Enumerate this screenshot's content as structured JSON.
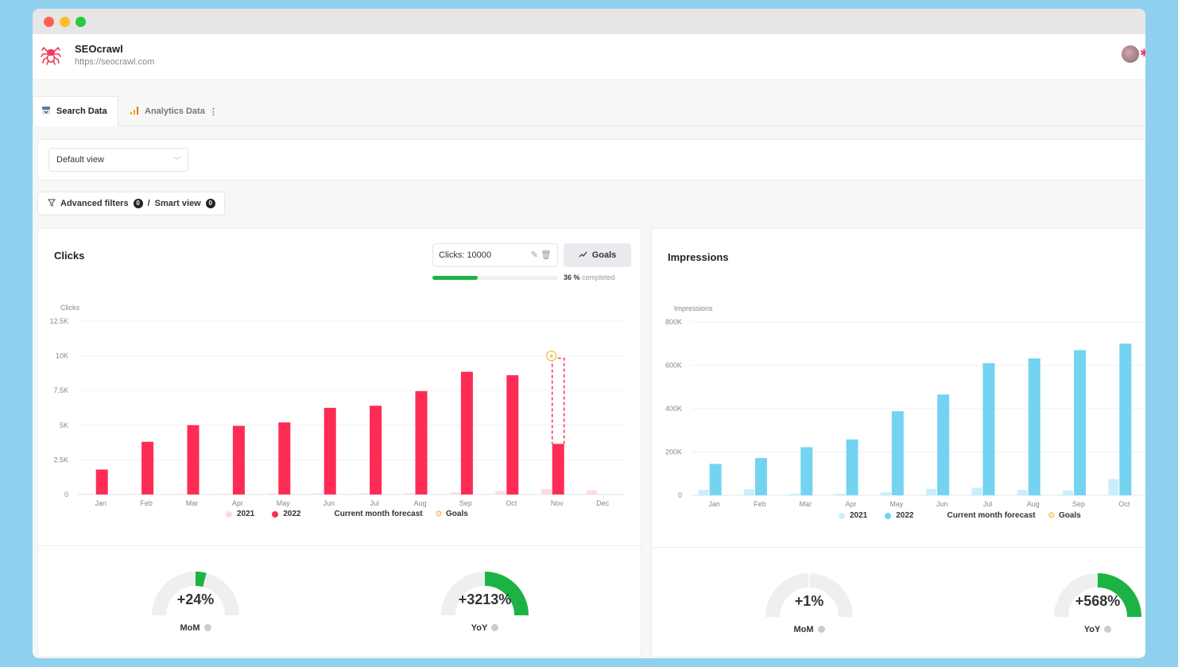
{
  "app": {
    "site_name": "SEOcrawl",
    "site_url": "https://seocrawl.com"
  },
  "tabs": [
    {
      "label": "Search Data",
      "icon": "search-console-icon",
      "active": true
    },
    {
      "label": "Analytics Data",
      "icon": "analytics-bar-icon",
      "active": false
    }
  ],
  "view_select": {
    "value": "Default view"
  },
  "filters": {
    "advanced_label": "Advanced filters",
    "advanced_count": "0",
    "separator": "/",
    "smart_label": "Smart view",
    "smart_count": "0"
  },
  "clicks_panel": {
    "title": "Clicks",
    "goal_input_value": "Clicks: 10000",
    "goals_button": "Goals",
    "progress_percent": 36,
    "progress_value_text": "36 %",
    "progress_suffix": "completed",
    "legend": {
      "y2021": "2021",
      "y2022": "2022",
      "forecast": "Current month forecast",
      "goals": "Goals"
    },
    "gauges": [
      {
        "value": "+24%",
        "label": "MoM",
        "fill": 0.08
      },
      {
        "value": "+3213%",
        "label": "YoY",
        "fill": 0.5
      }
    ]
  },
  "impressions_panel": {
    "title": "Impressions",
    "legend": {
      "y2021": "2021",
      "y2022": "2022",
      "forecast": "Current month forecast",
      "goals": "Goals"
    },
    "gauges": [
      {
        "value": "+1%",
        "label": "MoM",
        "fill": 0.0
      },
      {
        "value": "+568%",
        "label": "YoY",
        "fill": 0.5
      }
    ]
  },
  "colors": {
    "clicks_2022": "#fe2c55",
    "clicks_2021": "#fcdbe3",
    "impr_2022": "#74d3f1",
    "impr_2021": "#c9eefb",
    "goal_green": "#1db344",
    "goal_star": "#f5b942"
  },
  "chart_data": [
    {
      "type": "bar",
      "title": "Clicks",
      "ylabel": "Clicks",
      "categories": [
        "Jan",
        "Feb",
        "Mar",
        "Apr",
        "May",
        "Jun",
        "Jul",
        "Aug",
        "Sep",
        "Oct",
        "Nov",
        "Dec"
      ],
      "yticks": [
        "0",
        "2.5K",
        "5K",
        "7.5K",
        "10K",
        "12.5K"
      ],
      "ylim": [
        0,
        12500
      ],
      "series": [
        {
          "name": "2021",
          "values": [
            50,
            40,
            50,
            60,
            80,
            80,
            80,
            100,
            150,
            250,
            400,
            300
          ]
        },
        {
          "name": "2022",
          "values": [
            1800,
            3800,
            5000,
            4950,
            5200,
            6250,
            6400,
            7450,
            8850,
            8600,
            3650,
            null
          ]
        }
      ],
      "forecast": {
        "category": "Nov",
        "value": 10000
      },
      "goal": {
        "category": "Nov",
        "value": 10000
      },
      "legend": "bottom"
    },
    {
      "type": "bar",
      "title": "Impressions",
      "ylabel": "Impressions",
      "categories": [
        "Jan",
        "Feb",
        "Mar",
        "Apr",
        "May",
        "Jun",
        "Jul",
        "Aug",
        "Sep",
        "Oct"
      ],
      "yticks": [
        "0",
        "200K",
        "400K",
        "600K",
        "800K"
      ],
      "ylim": [
        0,
        800000
      ],
      "series": [
        {
          "name": "2021",
          "values": [
            25000,
            28000,
            8000,
            7000,
            14000,
            30000,
            35000,
            25000,
            22000,
            75000
          ]
        },
        {
          "name": "2022",
          "values": [
            145000,
            172000,
            222000,
            258000,
            388000,
            465000,
            610000,
            632000,
            670000,
            700000
          ]
        }
      ],
      "legend": "bottom"
    }
  ]
}
